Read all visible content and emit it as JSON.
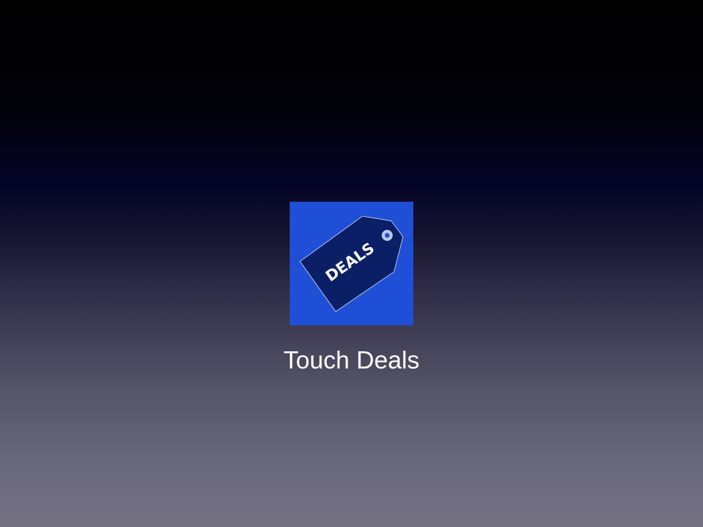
{
  "app": {
    "name": "Touch Deals",
    "icon": {
      "semantic": "price-tag-icon",
      "tag_text": "DEALS",
      "background_color": "#1f4fd6",
      "tag_color": "#0b1f66",
      "tag_outline_color": "#b9c6ee",
      "text_color": "#ffffff"
    }
  }
}
